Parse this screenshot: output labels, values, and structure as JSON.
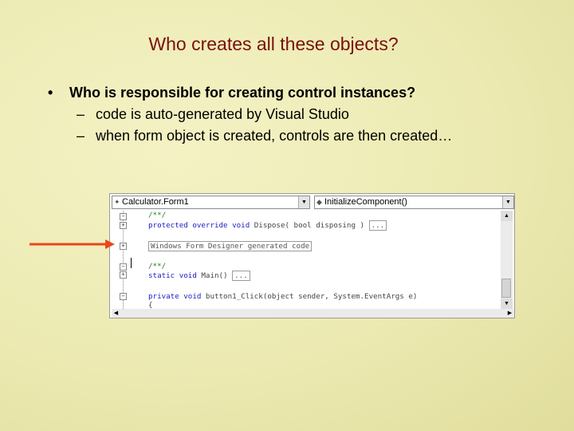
{
  "slide": {
    "title": "Who creates all these objects?",
    "bullet1": "Who is responsible for creating control instances?",
    "bullet_marker": "•",
    "sub_marker": "–",
    "sub1": "code is auto-generated by Visual Studio",
    "sub2": "when form object is created, controls are then created…"
  },
  "ide": {
    "class_combo": "Calculator.Form1",
    "member_combo": "InitializeComponent()",
    "code": {
      "l1": "/**/",
      "l2_kw": "protected override void",
      "l2_rest": " Dispose( bool disposing )",
      "l2_box": "...",
      "l3": "Windows Form Designer generated code",
      "l4": "/**/",
      "l5_kw": "static void",
      "l5_rest": " Main()",
      "l5_box": "...",
      "l6_kw": "private void",
      "l6_rest": " button1_Click(object sender, System.EventArgs e)",
      "l7": "{"
    }
  },
  "colors": {
    "title": "#7a1010",
    "arrow": "#e8481c",
    "keyword": "#2020c0",
    "comment": "#2a7a2a"
  }
}
